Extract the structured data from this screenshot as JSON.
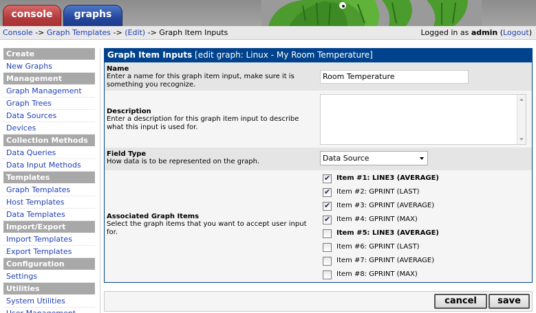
{
  "tabs": {
    "console": "console",
    "graphs": "graphs"
  },
  "breadcrumb": {
    "console": "Console",
    "sep1": " -> ",
    "graph_templates": "Graph Templates",
    "sep2": " -> ",
    "edit": "(Edit)",
    "sep3": " -> ",
    "current": "Graph Item Inputs"
  },
  "login": {
    "prefix": "Logged in as ",
    "user": "admin",
    "open": " (",
    "logout": "Logout",
    "close": ")"
  },
  "menu": [
    {
      "type": "head",
      "label": "Create"
    },
    {
      "type": "item",
      "label": "New Graphs"
    },
    {
      "type": "head",
      "label": "Management"
    },
    {
      "type": "item",
      "label": "Graph Management"
    },
    {
      "type": "item",
      "label": "Graph Trees"
    },
    {
      "type": "item",
      "label": "Data Sources"
    },
    {
      "type": "item",
      "label": "Devices"
    },
    {
      "type": "head",
      "label": "Collection Methods"
    },
    {
      "type": "item",
      "label": "Data Queries"
    },
    {
      "type": "item",
      "label": "Data Input Methods"
    },
    {
      "type": "head",
      "label": "Templates"
    },
    {
      "type": "item",
      "label": "Graph Templates"
    },
    {
      "type": "item",
      "label": "Host Templates"
    },
    {
      "type": "item",
      "label": "Data Templates"
    },
    {
      "type": "head",
      "label": "Import/Export"
    },
    {
      "type": "item",
      "label": "Import Templates"
    },
    {
      "type": "item",
      "label": "Export Templates"
    },
    {
      "type": "head",
      "label": "Configuration"
    },
    {
      "type": "item",
      "label": "Settings"
    },
    {
      "type": "head",
      "label": "Utilities"
    },
    {
      "type": "item",
      "label": "System Utilities"
    },
    {
      "type": "item",
      "label": "User Management"
    }
  ],
  "form": {
    "title": "Graph Item Inputs",
    "title_sub": " [edit graph: Linux - My Room Temperature]",
    "name": {
      "label": "Name",
      "desc": "Enter a name for this graph item input, make sure it is something you recognize.",
      "value": "Room Temperature"
    },
    "description": {
      "label": "Description",
      "desc": "Enter a description for this graph item input to describe what this input is used for.",
      "value": ""
    },
    "field_type": {
      "label": "Field Type",
      "desc": "How data is to be represented on the graph.",
      "value": "Data Source"
    },
    "graph_items": {
      "label": "Associated Graph Items",
      "desc": "Select the graph items that you want to accept user input for.",
      "items": [
        {
          "label": "Item #1: LINE3 (AVERAGE)",
          "checked": true,
          "bold": true
        },
        {
          "label": "Item #2: GPRINT (LAST)",
          "checked": true,
          "bold": false
        },
        {
          "label": "Item #3: GPRINT (AVERAGE)",
          "checked": true,
          "bold": false
        },
        {
          "label": "Item #4: GPRINT (MAX)",
          "checked": true,
          "bold": false
        },
        {
          "label": "Item #5: LINE3 (AVERAGE)",
          "checked": false,
          "bold": true
        },
        {
          "label": "Item #6: GPRINT (LAST)",
          "checked": false,
          "bold": false
        },
        {
          "label": "Item #7: GPRINT (AVERAGE)",
          "checked": false,
          "bold": false
        },
        {
          "label": "Item #8: GPRINT (MAX)",
          "checked": false,
          "bold": false
        }
      ]
    }
  },
  "buttons": {
    "cancel": "cancel",
    "save": "save"
  },
  "colors": {
    "header_blue": "#00438c",
    "link_blue": "#1f3fb5",
    "menu_head": "#a8a8a8"
  }
}
